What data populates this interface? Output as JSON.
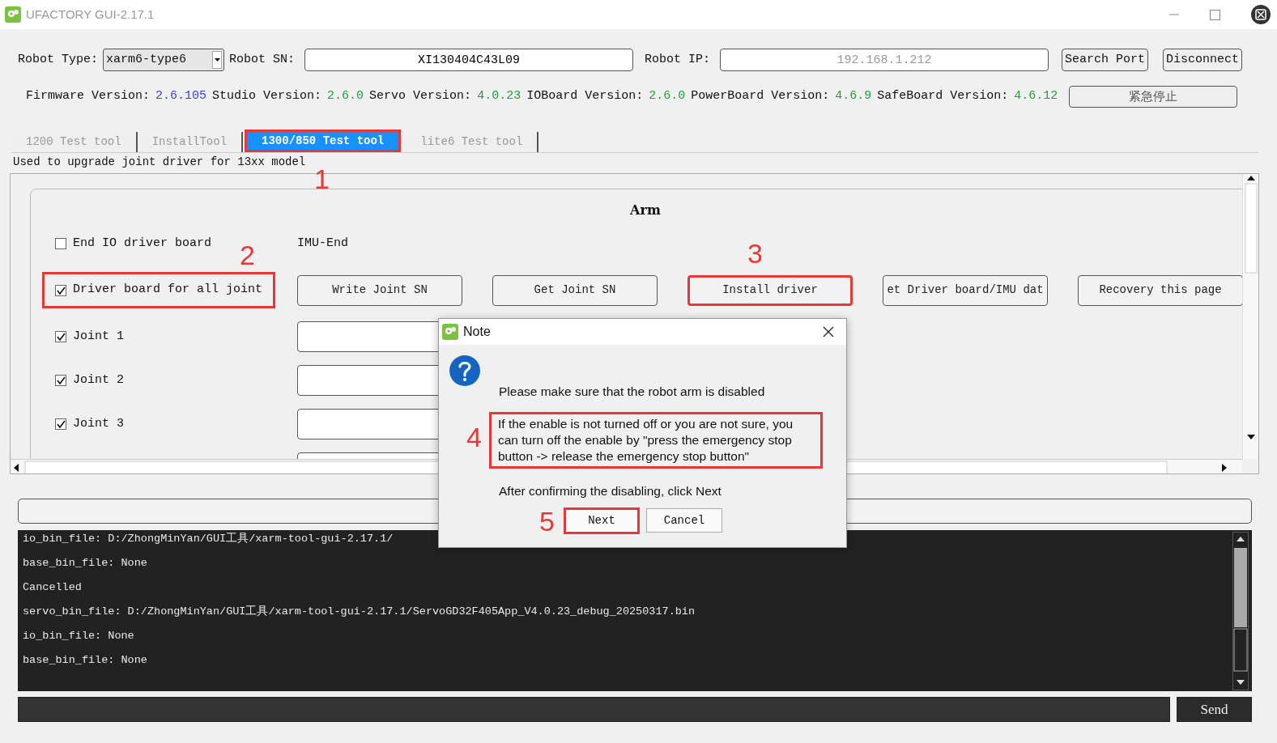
{
  "window": {
    "title": "UFACTORY GUI-2.17.1"
  },
  "connection": {
    "robot_type_label": "Robot Type:",
    "robot_type": "xarm6-type6",
    "robot_sn_label": "Robot SN:",
    "robot_sn": "XI130404C43L09",
    "robot_ip_label": "Robot IP:",
    "robot_ip_placeholder": "192.168.1.212",
    "buttons": [
      "Search Port",
      "Disconnect"
    ]
  },
  "versions": [
    {
      "label": "Firmware Version:",
      "value": "2.6.105",
      "color": "#3d3ddc"
    },
    {
      "label": "Studio Version:",
      "value": "2.6.0",
      "color": "#1f9e3a"
    },
    {
      "label": "Servo Version:",
      "value": "4.0.23",
      "color": "#1f9e3a"
    },
    {
      "label": "IOBoard Version:",
      "value": "2.6.0",
      "color": "#1f9e3a"
    },
    {
      "label": "PowerBoard Version:",
      "value": "4.6.9",
      "color": "#1f9e3a"
    },
    {
      "label": "SafeBoard Version:",
      "value": "4.6.12",
      "color": "#1f9e3a"
    }
  ],
  "emergency_button": "紧急停止",
  "tabs": [
    {
      "label": "1200 Test tool",
      "selected": false
    },
    {
      "label": "InstallTool",
      "selected": false
    },
    {
      "label": "1300/850 Test tool",
      "selected": true,
      "callout": "1"
    },
    {
      "label": "lite6 Test tool",
      "selected": false
    }
  ],
  "description": "Used to upgrade joint driver for 13xx model",
  "arm": {
    "title": "Arm",
    "end_io": {
      "label": "End IO driver board",
      "checked": false
    },
    "imu_label": "IMU-End",
    "all_joint": {
      "label": "Driver board for all joint",
      "checked": true,
      "callout": "2"
    },
    "actions": [
      {
        "label": "Write Joint SN"
      },
      {
        "label": "Get Joint SN"
      },
      {
        "label": "Install driver",
        "callout": "3"
      },
      {
        "label": "et Driver board/IMU dat"
      },
      {
        "label": "Recovery this page"
      }
    ],
    "joints": [
      {
        "label": "Joint 1",
        "checked": true
      },
      {
        "label": "Joint 2",
        "checked": true
      },
      {
        "label": "Joint 3",
        "checked": true
      }
    ]
  },
  "log": {
    "lines": [
      "io_bin_file: D:/ZhongMinYan/GUI工具/xarm-tool-gui-2.17.1/",
      "base_bin_file: None",
      "Cancelled",
      "servo_bin_file: D:/ZhongMinYan/GUI工具/xarm-tool-gui-2.17.1/ServoGD32F405App_V4.0.23_debug_20250317.bin",
      "io_bin_file: None",
      "base_bin_file: None"
    ]
  },
  "command": {
    "button": "Send"
  },
  "dialog": {
    "title": "Note",
    "message": "Please make sure that the robot arm is disabled",
    "warning": {
      "text": "If the enable is not turned off or you are not sure, you can turn off the enable by \"press the emergency stop button -> release the emergency stop button\"",
      "callout": "4"
    },
    "instruction": "After confirming the disabling, click Next",
    "buttons": [
      {
        "label": "Next",
        "callout": "5"
      },
      {
        "label": "Cancel"
      }
    ]
  }
}
